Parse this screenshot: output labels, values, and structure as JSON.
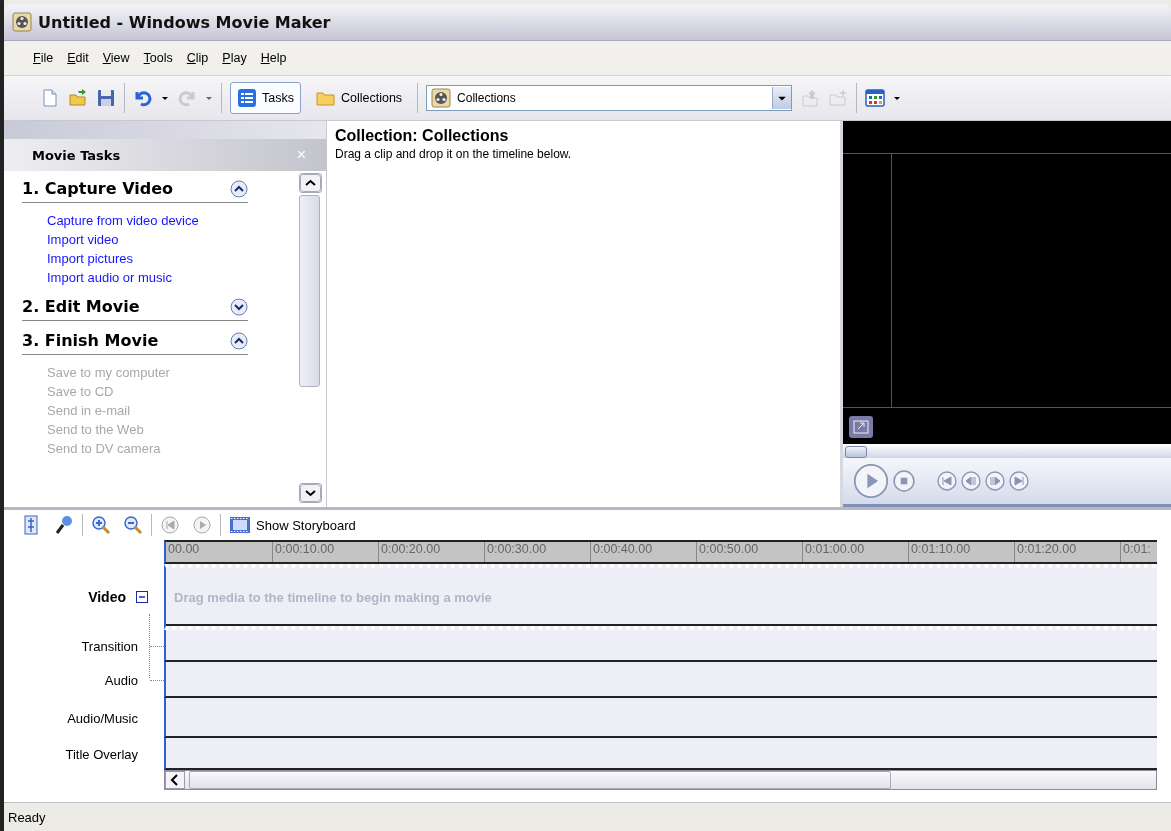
{
  "window": {
    "title": "Untitled - Windows Movie Maker"
  },
  "menu": [
    {
      "label": "File"
    },
    {
      "label": "Edit"
    },
    {
      "label": "View"
    },
    {
      "label": "Tools"
    },
    {
      "label": "Clip"
    },
    {
      "label": "Play"
    },
    {
      "label": "Help"
    }
  ],
  "toolbar": [
    [
      {
        "kind": "new",
        "disabled": false
      },
      {
        "kind": "open",
        "disabled": false
      },
      {
        "kind": "save",
        "disabled": false
      }
    ],
    [
      {
        "kind": "undo",
        "disabled": false
      },
      {
        "kind": "redo",
        "disabled": true
      }
    ],
    [
      {
        "kind": "tasks",
        "label": "Tasks",
        "selected": true
      },
      {
        "kind": "collections",
        "label": "Collections",
        "selected": false
      }
    ],
    [
      {
        "kind": "picker",
        "value": "Collections"
      },
      {
        "kind": "up",
        "disabled": true
      },
      {
        "kind": "new-folder",
        "disabled": true
      }
    ],
    [
      {
        "kind": "views",
        "disabled": false
      }
    ]
  ],
  "task_pane": {
    "title": "Movie Tasks",
    "close": "×",
    "sections": [
      {
        "title": "1. Capture Video",
        "expanded": true,
        "links": [
          {
            "label": "Capture from video device",
            "disabled": false
          },
          {
            "label": "Import video",
            "disabled": false
          },
          {
            "label": "Import pictures",
            "disabled": false
          },
          {
            "label": "Import audio or music",
            "disabled": false
          }
        ]
      },
      {
        "title": "2. Edit Movie",
        "expanded": false
      },
      {
        "title": "3. Finish Movie",
        "expanded": true,
        "links": [
          {
            "label": "Save to my computer",
            "disabled": true
          },
          {
            "label": "Save to CD",
            "disabled": true
          },
          {
            "label": "Send in e-mail",
            "disabled": true
          },
          {
            "label": "Send to the Web",
            "disabled": true
          },
          {
            "label": "Send to DV camera",
            "disabled": true
          }
        ]
      }
    ]
  },
  "collection": {
    "heading": "Collection: Collections",
    "hint": "Drag a clip and drop it on the timeline below."
  },
  "preview": {
    "seek": {
      "level": 0
    }
  },
  "timeline": {
    "toolbar": [
      [
        {
          "kind": "audio-levels"
        },
        {
          "kind": "narrate"
        }
      ],
      [
        {
          "kind": "zoom-in"
        },
        {
          "kind": "zoom-out"
        }
      ],
      [
        {
          "kind": "rewind",
          "disabled": true
        },
        {
          "kind": "play",
          "disabled": true
        }
      ],
      [
        {
          "kind": "storyboard",
          "label": "Show Storyboard"
        }
      ]
    ],
    "ruler": [
      "00.00",
      "0:00:10.00",
      "0:00:20.00",
      "0:00:30.00",
      "0:00:40.00",
      "0:00:50.00",
      "0:01:00.00",
      "0:01:10.00",
      "0:01:20.00",
      "0:01:"
    ],
    "tracks": [
      {
        "label": "Video",
        "kind": "video",
        "expanded": true,
        "hint": "Drag media to the timeline to begin making a movie"
      },
      {
        "label": "Transition",
        "kind": "sub"
      },
      {
        "label": "Audio",
        "kind": "sub"
      },
      {
        "label": "Audio/Music",
        "kind": "main"
      },
      {
        "label": "Title Overlay",
        "kind": "main"
      }
    ]
  },
  "status_bar": {
    "text": "Ready"
  }
}
